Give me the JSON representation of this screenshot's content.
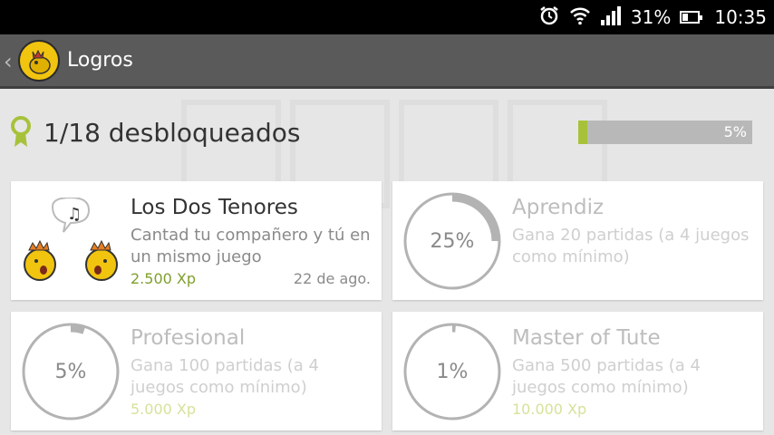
{
  "status_bar": {
    "battery": "31%",
    "time": "10:35",
    "battery_fraction": 0.31
  },
  "action_bar": {
    "title": "Logros",
    "back_icon": "chevron-left-icon",
    "logo_icon": "tute-logo-icon"
  },
  "summary": {
    "text": "1/18 desbloqueados",
    "progress_label": "5%",
    "progress_fraction": 0.05,
    "colors": {
      "progress_fill": "#a7c23a",
      "progress_track": "#b8b8b8"
    }
  },
  "achievements": [
    {
      "title": "Los Dos Tenores",
      "description": "Cantad tu compañero y tú en un mismo juego",
      "xp": "2.500 Xp",
      "date": "22 de ago.",
      "unlocked": true,
      "image": "two-tenors-icon"
    },
    {
      "title": "Aprendiz",
      "description": "Gana 20 partidas (a 4 juegos como mínimo)",
      "percent_label": "25%",
      "progress_fraction": 0.25,
      "unlocked": false
    },
    {
      "title": "Profesional",
      "description": "Gana 100 partidas (a 4 juegos como mínimo)",
      "xp": "5.000 Xp",
      "percent_label": "5%",
      "progress_fraction": 0.05,
      "unlocked": false
    },
    {
      "title": "Master of Tute",
      "description": "Gana 500 partidas (a 4 juegos como mínimo)",
      "xp": "10.000 Xp",
      "percent_label": "1%",
      "progress_fraction": 0.01,
      "unlocked": false
    }
  ]
}
